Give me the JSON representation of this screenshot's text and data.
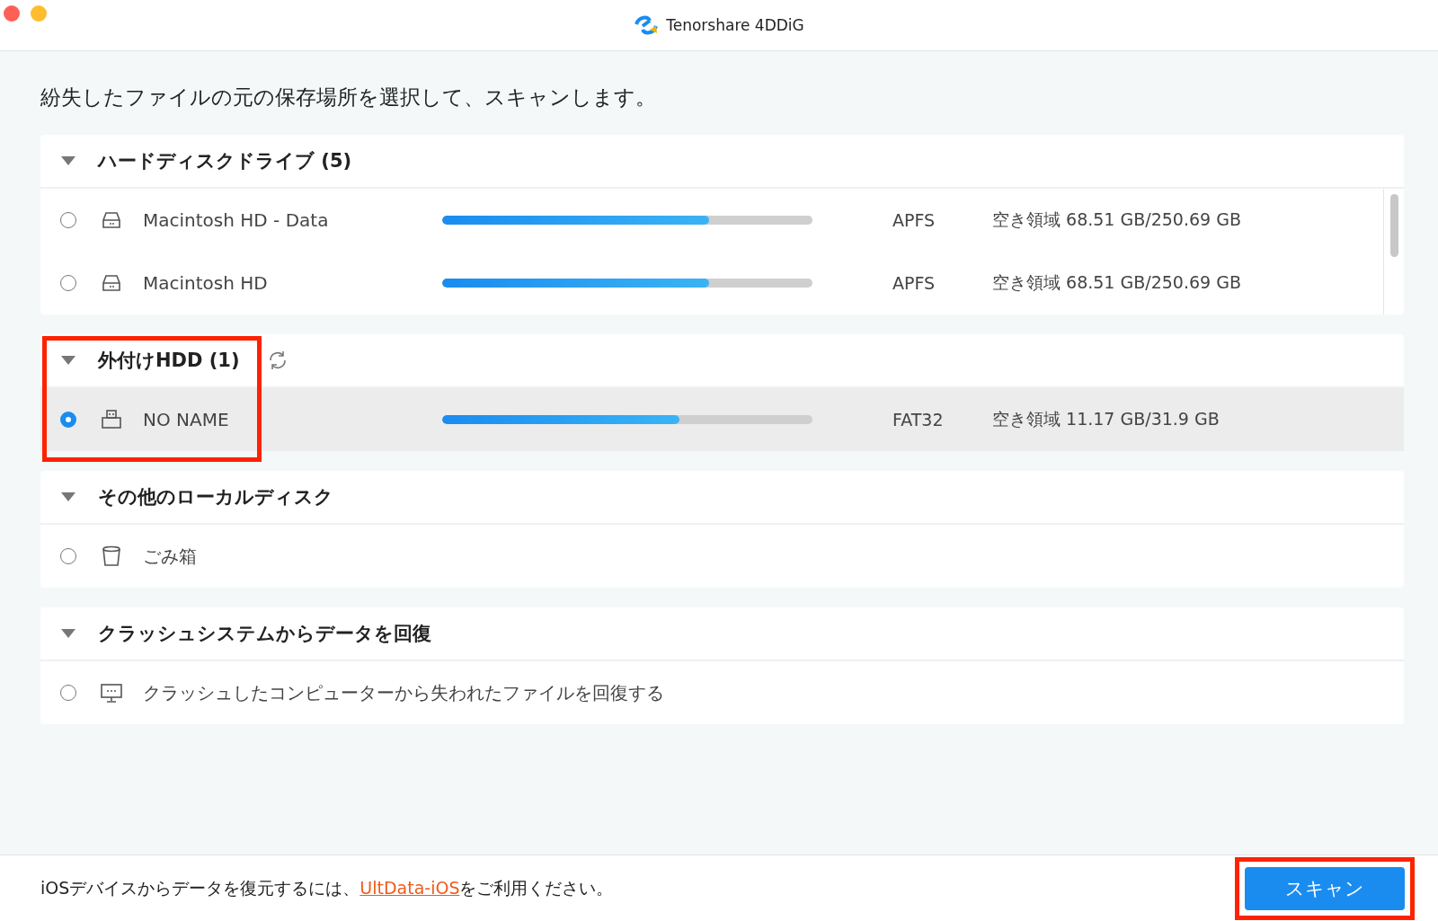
{
  "window": {
    "title": "Tenorshare 4DDiG"
  },
  "heading": "紛失したファイルの元の保存場所を選択して、スキャンします。",
  "sections": [
    {
      "title": "ハードディスクドライブ (5)",
      "expanded": true,
      "refreshable": false,
      "highlighted": false,
      "items": [
        {
          "kind": "internal",
          "name": "Macintosh HD - Data",
          "selected": false,
          "level": 0.72,
          "filesystem": "APFS",
          "space": "空き領域 68.51 GB/250.69 GB"
        },
        {
          "kind": "internal",
          "name": "Macintosh HD",
          "selected": false,
          "level": 0.72,
          "filesystem": "APFS",
          "space": "空き領域 68.51 GB/250.69 GB"
        }
      ]
    },
    {
      "title": "外付けHDD (1)",
      "expanded": true,
      "refreshable": true,
      "highlighted": true,
      "items": [
        {
          "kind": "external",
          "name": "NO NAME",
          "selected": true,
          "level": 0.64,
          "filesystem": "FAT32",
          "space": "空き領域 11.17 GB/31.9 GB"
        }
      ]
    },
    {
      "title": "その他のローカルディスク",
      "expanded": true,
      "refreshable": false,
      "highlighted": false,
      "items": [
        {
          "kind": "trash",
          "name": "ごみ箱",
          "selected": false
        }
      ]
    },
    {
      "title": "クラッシュシステムからデータを回復",
      "expanded": true,
      "refreshable": false,
      "highlighted": false,
      "items": [
        {
          "kind": "crash",
          "name": "クラッシュしたコンピューターから失われたファイルを回復する",
          "selected": false
        }
      ]
    }
  ],
  "footer": {
    "before": "iOSデバイスからデータを復元するには、",
    "link": "UltData-iOS",
    "after": "をご利用ください。"
  },
  "scan_button": {
    "label": "スキャン",
    "highlighted": true
  }
}
